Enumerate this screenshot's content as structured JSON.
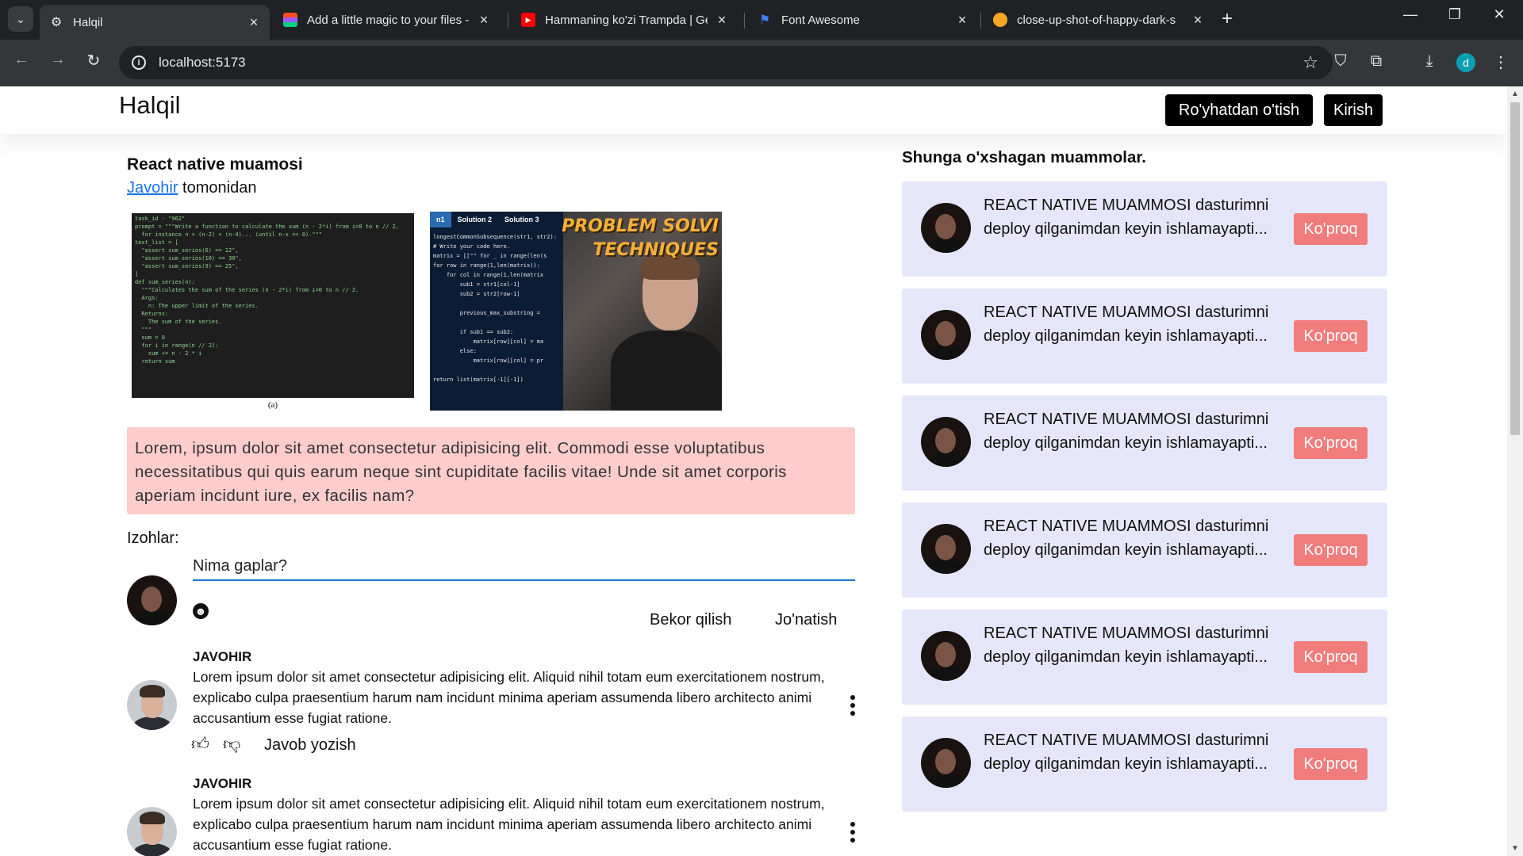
{
  "browser": {
    "tabs": [
      {
        "title": "Halqil",
        "active": true
      },
      {
        "title": "Add a little magic to your files -"
      },
      {
        "title": "Hammaning ko'zi Trampda | Ge"
      },
      {
        "title": "Font Awesome"
      },
      {
        "title": "close-up-shot-of-happy-dark-s"
      }
    ],
    "url": "localhost:5173",
    "profile_initial": "d"
  },
  "header": {
    "logo": "Halqil",
    "register_label": "Ro'yhatdan o'tish",
    "login_label": "Kirish"
  },
  "post": {
    "title": "React native muamosi",
    "author": "Javohir",
    "author_suffix": " tomonidan",
    "image1_caption": "(a)",
    "image2_title_line1": "PROBLEM SOLVI",
    "image2_title_line2": "TECHNIQUES",
    "body": "Lorem, ipsum dolor sit amet consectetur adipisicing elit. Commodi esse voluptatibus necessitatibus qui quis earum neque sint cupiditate facilis vitae! Unde sit amet corporis aperiam incidunt iure, ex facilis nam?"
  },
  "comments_section": {
    "heading": "Izohlar:",
    "input_value": "Nima gaplar?",
    "cancel_label": "Bekor qilish",
    "send_label": "Jo'natish",
    "reply_label": "Javob yozish",
    "comments": [
      {
        "author": "JAVOHIR",
        "text": "Lorem ipsum dolor sit amet consectetur adipisicing elit. Aliquid nihil totam eum exercitationem nostrum, explicabo culpa praesentium harum nam incidunt minima aperiam assumenda libero architecto animi accusantium esse fugiat ratione."
      },
      {
        "author": "JAVOHIR",
        "text": "Lorem ipsum dolor sit amet consectetur adipisicing elit. Aliquid nihil totam eum exercitationem nostrum, explicabo culpa praesentium harum nam incidunt minima aperiam assumenda libero architecto animi accusantium esse fugiat ratione."
      }
    ]
  },
  "sidebar": {
    "title": "Shunga o'xshagan muammolar.",
    "cards": [
      {
        "text": "REACT NATIVE MUAMMOSI dasturimni deploy qilganimdan keyin ishlamayapti...",
        "button": "Ko'proq"
      },
      {
        "text": "REACT NATIVE MUAMMOSI dasturimni deploy qilganimdan keyin ishlamayapti...",
        "button": "Ko'proq"
      },
      {
        "text": "REACT NATIVE MUAMMOSI dasturimni deploy qilganimdan keyin ishlamayapti...",
        "button": "Ko'proq"
      },
      {
        "text": "REACT NATIVE MUAMMOSI dasturimni deploy qilganimdan keyin ishlamayapti...",
        "button": "Ko'proq"
      },
      {
        "text": "REACT NATIVE MUAMMOSI dasturimni deploy qilganimdan keyin ishlamayapti...",
        "button": "Ko'proq"
      },
      {
        "text": "REACT NATIVE MUAMMOSI dasturimni deploy qilganimdan keyin ishlamayapti...",
        "button": "Ko'proq"
      }
    ]
  },
  "colors": {
    "lorem_bg": "#ffcccc",
    "card_bg": "#e6e6fa",
    "card_button": "#f07c7c",
    "link": "#1a73e8"
  }
}
